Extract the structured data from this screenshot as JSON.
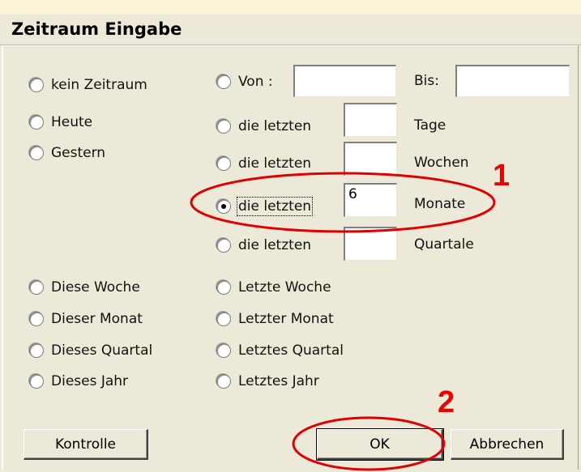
{
  "dialog": {
    "title": "Zeitraum Eingabe"
  },
  "left_options": [
    {
      "label": "kein Zeitraum",
      "checked": false
    },
    {
      "label": "Heute",
      "checked": false
    },
    {
      "label": "Gestern",
      "checked": false
    }
  ],
  "range": {
    "von_label": "Von :",
    "von_value": "",
    "bis_label": "Bis:",
    "bis_value": ""
  },
  "relative": [
    {
      "label": "die letzten",
      "value": "",
      "unit": "Tage",
      "checked": false
    },
    {
      "label": "die letzten",
      "value": "",
      "unit": "Wochen",
      "checked": false
    },
    {
      "label": "die letzten",
      "value": "6",
      "unit": "Monate",
      "checked": true
    },
    {
      "label": "die letzten",
      "value": "",
      "unit": "Quartale",
      "checked": false
    }
  ],
  "current_periods": [
    {
      "label": "Diese Woche",
      "checked": false
    },
    {
      "label": "Dieser Monat",
      "checked": false
    },
    {
      "label": "Dieses Quartal",
      "checked": false
    },
    {
      "label": "Dieses Jahr",
      "checked": false
    }
  ],
  "last_periods": [
    {
      "label": "Letzte Woche",
      "checked": false
    },
    {
      "label": "Letzter Monat",
      "checked": false
    },
    {
      "label": "Letztes Quartal",
      "checked": false
    },
    {
      "label": "Letztes Jahr",
      "checked": false
    }
  ],
  "buttons": {
    "kontrolle": "Kontrolle",
    "ok": "OK",
    "abbrechen": "Abbrechen"
  },
  "annotations": {
    "marker_1": "1",
    "marker_2": "2",
    "color": "#e00000"
  }
}
